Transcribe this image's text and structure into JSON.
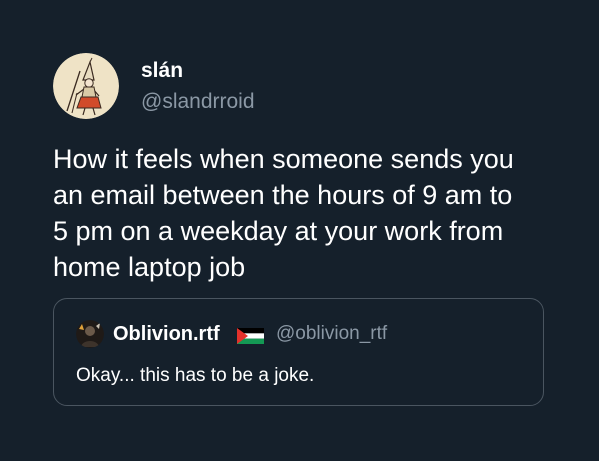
{
  "tweet": {
    "author": {
      "display_name": "slán",
      "handle": "@slandrroid",
      "avatar_icon": "illustrated-figure-avatar"
    },
    "text_lines": [
      "How it feels when someone sends you",
      "an email between the hours of 9 am to",
      "5 pm on a weekday at your work from",
      "home laptop job"
    ]
  },
  "quote": {
    "author": {
      "display_name": "Oblivion.rtf",
      "handle": "@oblivion_rtf",
      "avatar_icon": "dark-portrait-avatar",
      "flag_icon": "palestine-flag-icon"
    },
    "text": "Okay... this has to be a joke."
  },
  "colors": {
    "background": "#15202b",
    "primary_text": "#ffffff",
    "secondary_text": "#8b98a5",
    "card_border": "#4a5560"
  }
}
